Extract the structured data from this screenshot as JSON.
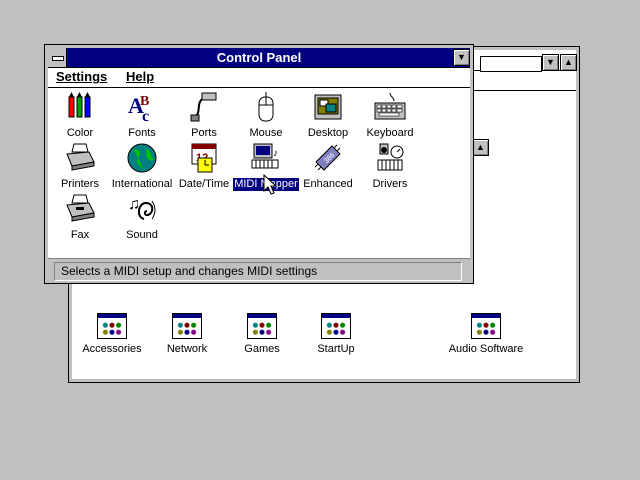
{
  "program_manager": {
    "groups": [
      {
        "label": "Accessories"
      },
      {
        "label": "Network"
      },
      {
        "label": "Games"
      },
      {
        "label": "StartUp"
      },
      {
        "label": "Audio Software"
      }
    ]
  },
  "control_panel": {
    "title": "Control Panel",
    "menu": {
      "settings": "Settings",
      "help": "Help"
    },
    "applets": [
      {
        "label": "Color",
        "icon": "color-icon"
      },
      {
        "label": "Fonts",
        "icon": "fonts-icon"
      },
      {
        "label": "Ports",
        "icon": "ports-icon"
      },
      {
        "label": "Mouse",
        "icon": "mouse-icon"
      },
      {
        "label": "Desktop",
        "icon": "desktop-icon"
      },
      {
        "label": "Keyboard",
        "icon": "keyboard-icon"
      },
      {
        "label": "Printers",
        "icon": "printers-icon"
      },
      {
        "label": "International",
        "icon": "international-icon"
      },
      {
        "label": "Date/Time",
        "icon": "datetime-icon"
      },
      {
        "label": "MIDI Mapper",
        "icon": "midi-mapper-icon",
        "selected": true
      },
      {
        "label": "Enhanced",
        "icon": "enhanced-icon"
      },
      {
        "label": "Drivers",
        "icon": "drivers-icon"
      },
      {
        "label": "Fax",
        "icon": "fax-icon"
      },
      {
        "label": "Sound",
        "icon": "sound-icon"
      }
    ],
    "status": "Selects a MIDI setup and changes MIDI settings"
  },
  "colors": {
    "title_active": "#000080",
    "face": "#c0c0c0",
    "selection": "#000080"
  }
}
